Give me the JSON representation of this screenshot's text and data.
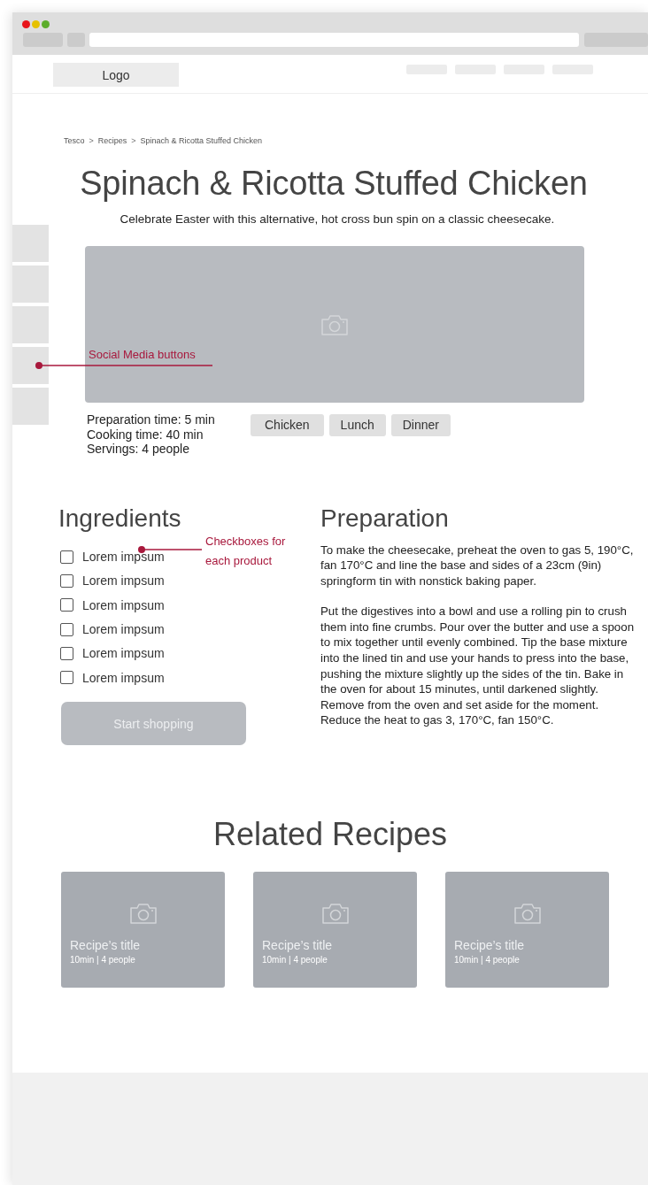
{
  "header": {
    "logo": "Logo"
  },
  "breadcrumb": [
    {
      "kind": "link",
      "text": "Tesco"
    },
    {
      "kind": "separator",
      "text": ">"
    },
    {
      "kind": "link",
      "text": "Recipes"
    },
    {
      "kind": "separator",
      "text": ">"
    },
    {
      "kind": "current",
      "text": "Spinach & Ricotta Stuffed Chicken"
    }
  ],
  "title": "Spinach & Ricotta Stuffed Chicken",
  "subtitle": "Celebrate Easter with this alternative, hot cross bun spin on a classic cheesecake.",
  "details": [
    "Preparation time: 5 min",
    "Cooking time: 40 min",
    "Servings: 4 people"
  ],
  "tags": [
    "Chicken",
    "Lunch",
    "Dinner"
  ],
  "annotations": [
    {
      "kind": "social",
      "text": "Social Media buttons"
    },
    {
      "kind": "checkbox",
      "text": "Checkboxes for each product"
    }
  ],
  "ingredients": {
    "heading": "Ingredients",
    "items": [
      {
        "label": "Lorem impsum",
        "checked": false
      },
      {
        "label": "Lorem impsum",
        "checked": false
      },
      {
        "label": "Lorem impsum",
        "checked": false
      },
      {
        "label": "Lorem impsum",
        "checked": false
      },
      {
        "label": "Lorem impsum",
        "checked": false
      },
      {
        "label": "Lorem impsum",
        "checked": false
      }
    ],
    "button": "Start shopping"
  },
  "preparation": {
    "heading": "Preparation",
    "paragraphs": [
      "To make the cheesecake, preheat the oven to gas 5, 190°C, fan 170°C and line the base and sides of a 23cm (9in) springform tin with nonstick baking paper.",
      "Put the digestives into a bowl and use a rolling pin to crush them into fine crumbs. Pour over the butter and use a spoon to mix together until evenly combined. Tip the base mixture into the lined tin and use your hands to press into the base, pushing the mixture slightly up the sides of the tin. Bake in the oven for about 15 minutes, until darkened slightly. Remove from the oven and set aside for the moment. Reduce the heat to gas 3, 170°C, fan 150°C."
    ]
  },
  "related": {
    "heading": "Related Recipes",
    "cards": [
      {
        "title": "Recipe’s title",
        "meta": "10min | 4 people"
      },
      {
        "title": "Recipe’s title",
        "meta": "10min | 4 people"
      },
      {
        "title": "Recipe’s title",
        "meta": "10min | 4 people"
      }
    ]
  }
}
